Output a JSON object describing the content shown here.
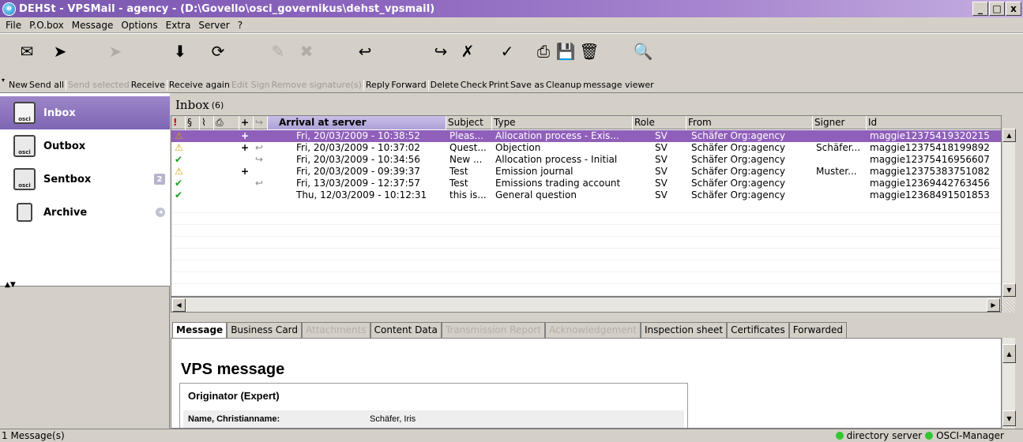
{
  "window": {
    "title": "DEHSt - VPSMail - agency - (D:\\Govello\\osci_governikus\\dehst_vpsmail)",
    "minimize": "_",
    "maximize": "□",
    "close": "x"
  },
  "menu": [
    "File",
    "P.O.box",
    "Message",
    "Options",
    "Extra",
    "Server",
    "?"
  ],
  "toolbar": {
    "buttons": [
      {
        "label": "New",
        "icon": "new-message-icon",
        "glyph": "✉",
        "enabled": true
      },
      {
        "label": "Send all",
        "icon": "send-all-icon",
        "glyph": "➤",
        "enabled": true
      },
      {
        "label": "Send selected",
        "icon": "send-selected-icon",
        "glyph": "➤",
        "enabled": false
      },
      {
        "label": "Receive",
        "icon": "receive-icon",
        "glyph": "⬇",
        "enabled": true
      },
      {
        "label": "Receive again",
        "icon": "receive-again-icon",
        "glyph": "⟳",
        "enabled": true
      },
      {
        "label": "Edit Sign",
        "icon": "edit-sign-icon",
        "glyph": "✎",
        "enabled": false
      },
      {
        "label": "Remove signature(s)",
        "icon": "remove-signature-icon",
        "glyph": "✖",
        "enabled": false
      },
      {
        "label": "Reply",
        "icon": "reply-icon",
        "glyph": "↩",
        "enabled": true
      },
      {
        "label": "Forward",
        "icon": "forward-icon",
        "glyph": "↪",
        "enabled": true
      },
      {
        "label": "Delete",
        "icon": "delete-icon",
        "glyph": "✗",
        "enabled": true
      },
      {
        "label": "Check",
        "icon": "check-icon",
        "glyph": "✓",
        "enabled": true
      },
      {
        "label": "Print",
        "icon": "print-icon",
        "glyph": "⎙",
        "enabled": true
      },
      {
        "label": "Save as",
        "icon": "save-icon",
        "glyph": "💾",
        "enabled": true
      },
      {
        "label": "Cleanup",
        "icon": "cleanup-icon",
        "glyph": "🗑",
        "enabled": true
      },
      {
        "label": "message viewer",
        "icon": "search-icon",
        "glyph": "🔍",
        "enabled": true
      }
    ]
  },
  "nav": {
    "items": [
      {
        "label": "Inbox",
        "badge": ""
      },
      {
        "label": "Outbox",
        "badge": ""
      },
      {
        "label": "Sentbox",
        "badge": "2"
      },
      {
        "label": "Archive",
        "badge": ""
      }
    ]
  },
  "inbox": {
    "title": "Inbox",
    "count": "(6)",
    "columns": {
      "marks": "§",
      "plus": "+",
      "arrival": "Arrival at server",
      "subject": "Subject",
      "type": "Type",
      "role": "Role",
      "from": "From",
      "signer": "Signer",
      "id": "Id"
    },
    "rows": [
      {
        "status": "⚠",
        "plus": "+",
        "fwd": "",
        "arrival": "Fri, 20/03/2009 - 10:38:52",
        "subject": "Pleas...",
        "type": "Allocation process - Exis...",
        "role": "SV",
        "from": "Schäfer Org:agency",
        "signer": "",
        "id": "maggie12375419320215"
      },
      {
        "status": "⚠",
        "plus": "+",
        "fwd": "↩",
        "arrival": "Fri, 20/03/2009 - 10:37:02",
        "subject": "Quest...",
        "type": "Objection",
        "role": "SV",
        "from": "Schäfer Org:agency",
        "signer": "Schäfer...",
        "id": "maggie12375418199892"
      },
      {
        "status": "✔",
        "plus": "",
        "fwd": "↪",
        "arrival": "Fri, 20/03/2009 - 10:34:56",
        "subject": "New ...",
        "type": "Allocation process - Initial",
        "role": "SV",
        "from": "Schäfer Org:agency",
        "signer": "",
        "id": "maggie12375416956607"
      },
      {
        "status": "⚠",
        "plus": "+",
        "fwd": "",
        "arrival": "Fri, 20/03/2009 - 09:39:37",
        "subject": "Test",
        "type": "Emission journal",
        "role": "SV",
        "from": "Schäfer Org:agency",
        "signer": "Muster...",
        "id": "maggie12375383751082"
      },
      {
        "status": "✔",
        "plus": "",
        "fwd": "↩",
        "arrival": "Fri, 13/03/2009 - 12:37:57",
        "subject": "Test",
        "type": "Emissions trading account",
        "role": "SV",
        "from": "Schäfer Org:agency",
        "signer": "",
        "id": "maggie12369442763456"
      },
      {
        "status": "✔",
        "plus": "",
        "fwd": "",
        "arrival": "Thu, 12/03/2009 - 10:12:31",
        "subject": "this is...",
        "type": "General question",
        "role": "SV",
        "from": "Schäfer Org:agency",
        "signer": "",
        "id": "maggie12368491501853"
      }
    ]
  },
  "tabs": [
    {
      "label": "Message",
      "state": "active"
    },
    {
      "label": "Business Card",
      "state": "normal"
    },
    {
      "label": "Attachments",
      "state": "disabled"
    },
    {
      "label": "Content Data",
      "state": "normal"
    },
    {
      "label": "Transmission Report",
      "state": "disabled"
    },
    {
      "label": "Acknowledgement",
      "state": "disabled"
    },
    {
      "label": "Inspection sheet",
      "state": "normal"
    },
    {
      "label": "Certificates",
      "state": "normal"
    },
    {
      "label": "Forwarded",
      "state": "normal"
    }
  ],
  "viewer": {
    "heading": "VPS message",
    "originator_title": "Originator (Expert)",
    "name_label": "Name, Christianname:",
    "name_value": "Schäfer, Iris"
  },
  "status": {
    "left": "1 Message(s)",
    "directory": "directory server",
    "osci": "OSCI-Manager"
  },
  "colors": {
    "selection": "#8f5fba",
    "status_ok": "#2fc82f"
  }
}
